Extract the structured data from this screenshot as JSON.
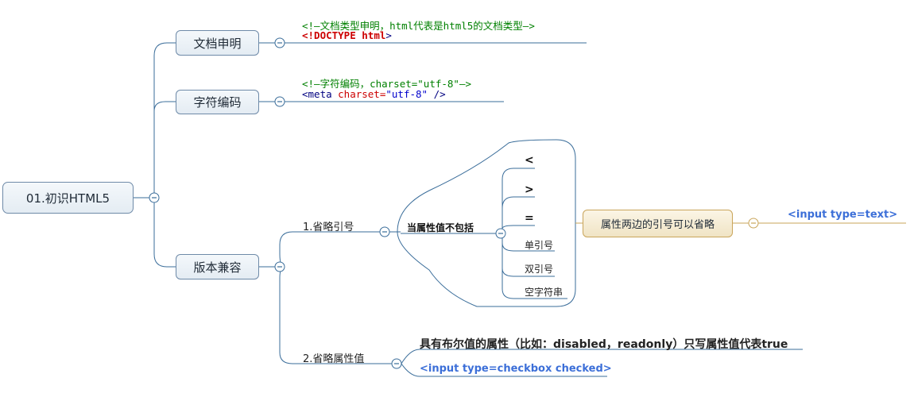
{
  "root": {
    "label": "01.初识HTML5"
  },
  "branches": {
    "doc": {
      "label": "文档申明",
      "comment": "<!—文档类型申明，html代表是html5的文档类型—>",
      "code_open": "<!DOCTYPE ",
      "code_kw": "html",
      "code_close": ">"
    },
    "charset": {
      "label": "字符编码",
      "comment": "<!—字符编码，charset=\"utf-8\"—>",
      "code_tag": "<meta ",
      "code_attr": "charset=",
      "code_val": "\"utf-8\"",
      "code_close": " />"
    },
    "compat": {
      "label": "版本兼容",
      "quotes": {
        "label": "1.省略引号",
        "condition": "当属性值不包括",
        "items": [
          "<",
          ">",
          "=",
          "单引号",
          "双引号",
          "空字符串"
        ],
        "conclusion": "属性两边的引号可以省略",
        "example": "<input type=text>"
      },
      "attrs": {
        "label": "2.省略属性值",
        "desc": "具有布尔值的属性（比如：disabled，readonly）只写属性值代表true",
        "example": "<input type=checkbox checked>"
      }
    }
  },
  "colors": {
    "line": "#3a6d9a",
    "line_warm": "#c9a55a",
    "node_border": "#6e8aa8"
  }
}
